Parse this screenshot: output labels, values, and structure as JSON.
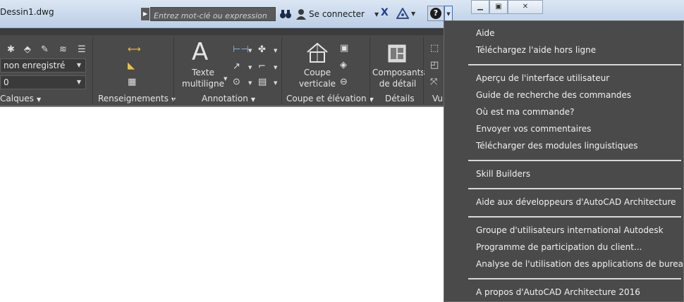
{
  "window": {
    "doc_title": "Dessin1.dwg",
    "search_placeholder": "Entrez mot-clé ou expression",
    "signin_label": "Se connecter"
  },
  "ribbon": {
    "layer_state": "non enregistré",
    "layer_value": "0",
    "panels": {
      "calques": "Calques",
      "renseignements": "Renseignements",
      "annotation": "Annotation",
      "coupe": "Coupe et élévation",
      "details": "Détails",
      "vue": "Vu"
    },
    "texte_multiligne": [
      "Texte",
      "multiligne"
    ],
    "coupe_verticale": [
      "Coupe",
      "verticale"
    ],
    "composants_detail": [
      "Composants",
      "de détail"
    ]
  },
  "help_menu": {
    "groups": [
      [
        "Aide",
        "Téléchargez l'aide hors ligne"
      ],
      [
        "Aperçu de l'interface utilisateur",
        "Guide de recherche des commandes",
        "Où est ma commande?",
        "Envoyer vos commentaires",
        "Télécharger des modules linguistiques"
      ],
      [
        "Skill Builders"
      ],
      [
        "Aide aux développeurs d'AutoCAD Architecture"
      ],
      [
        "Groupe d'utilisateurs international Autodesk",
        "Programme de participation du client...",
        "Analyse de l'utilisation des applications de bureau..."
      ],
      [
        "A propos d'AutoCAD Architecture 2016"
      ]
    ]
  },
  "colors": {
    "ribbon_bg": "#4a4a4a",
    "menu_bg": "#4a4a4a",
    "titlebar": "#c9d9ec"
  }
}
